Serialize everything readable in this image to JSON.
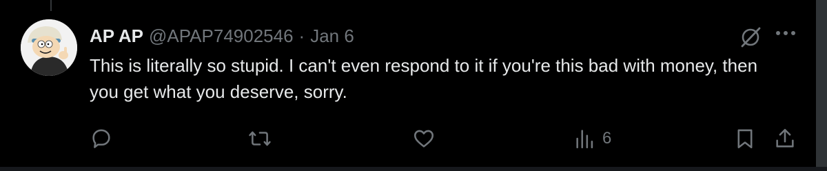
{
  "tweet": {
    "author_name": "AP AP",
    "handle": "@APAP74902546",
    "separator": "·",
    "date": "Jan 6",
    "text": "This is literally so stupid. I can't even respond to it if you're this bad with money, then you get what you deserve, sorry."
  },
  "actions": {
    "reply_icon": "reply-icon",
    "retweet_icon": "retweet-icon",
    "like_icon": "heart-icon",
    "views_icon": "bar-chart-icon",
    "views_count": "6",
    "bookmark_icon": "bookmark-icon",
    "share_icon": "share-icon"
  },
  "header_icons": {
    "grok": "grok-icon",
    "more": "more-icon"
  },
  "colors": {
    "background": "#000000",
    "text_primary": "#e7e9ea",
    "text_secondary": "#71767b",
    "border": "#2f3336"
  }
}
